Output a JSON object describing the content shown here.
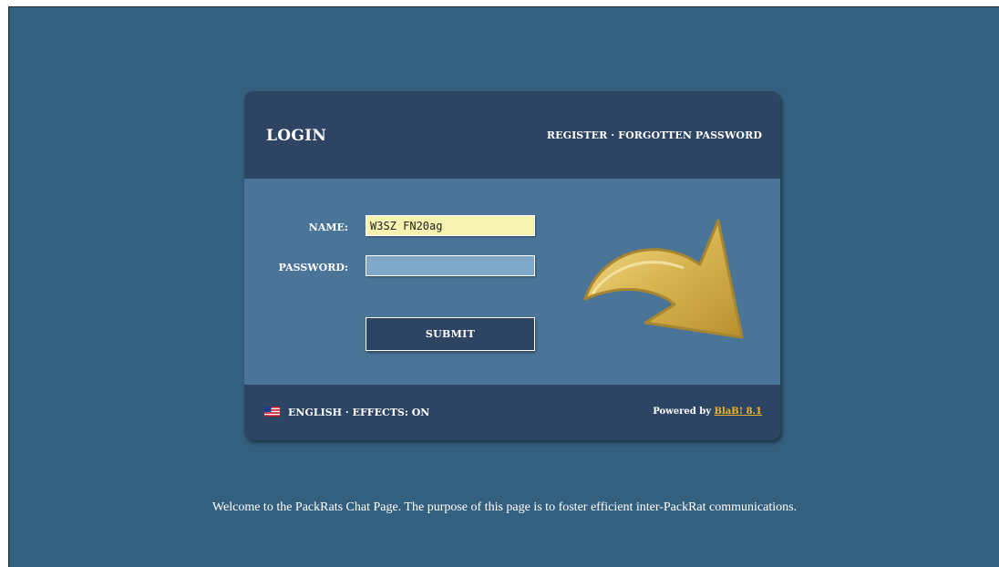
{
  "login": {
    "title": "LOGIN",
    "register_link": "REGISTER",
    "link_separator": " · ",
    "forgotten_link": "FORGOTTEN PASSWORD",
    "name_label": "NAME:",
    "name_value": "W3SZ FN20ag",
    "password_label": "PASSWORD:",
    "password_value": "",
    "submit_label": "SUBMIT"
  },
  "footer": {
    "language": "ENGLISH",
    "separator": " · ",
    "effects": "EFFECTS: ON",
    "powered_by": "Powered by ",
    "product_link": "BlaB! 8.1"
  },
  "welcome_message": "Welcome to the PackRats Chat Page. The purpose of this page is to foster efficient inter-PackRat communications.",
  "icons": {
    "flag": "us-flag-icon",
    "arrow": "curved-arrow-icon"
  },
  "colors": {
    "page_bg": "#33607f",
    "panel_dark": "#2d4563",
    "panel_body": "#4b7598",
    "name_input_bg": "#f6f3b0",
    "password_input_bg": "#80a8c8",
    "link_accent": "#f0b429",
    "arrow_gold": "#d8b450"
  }
}
